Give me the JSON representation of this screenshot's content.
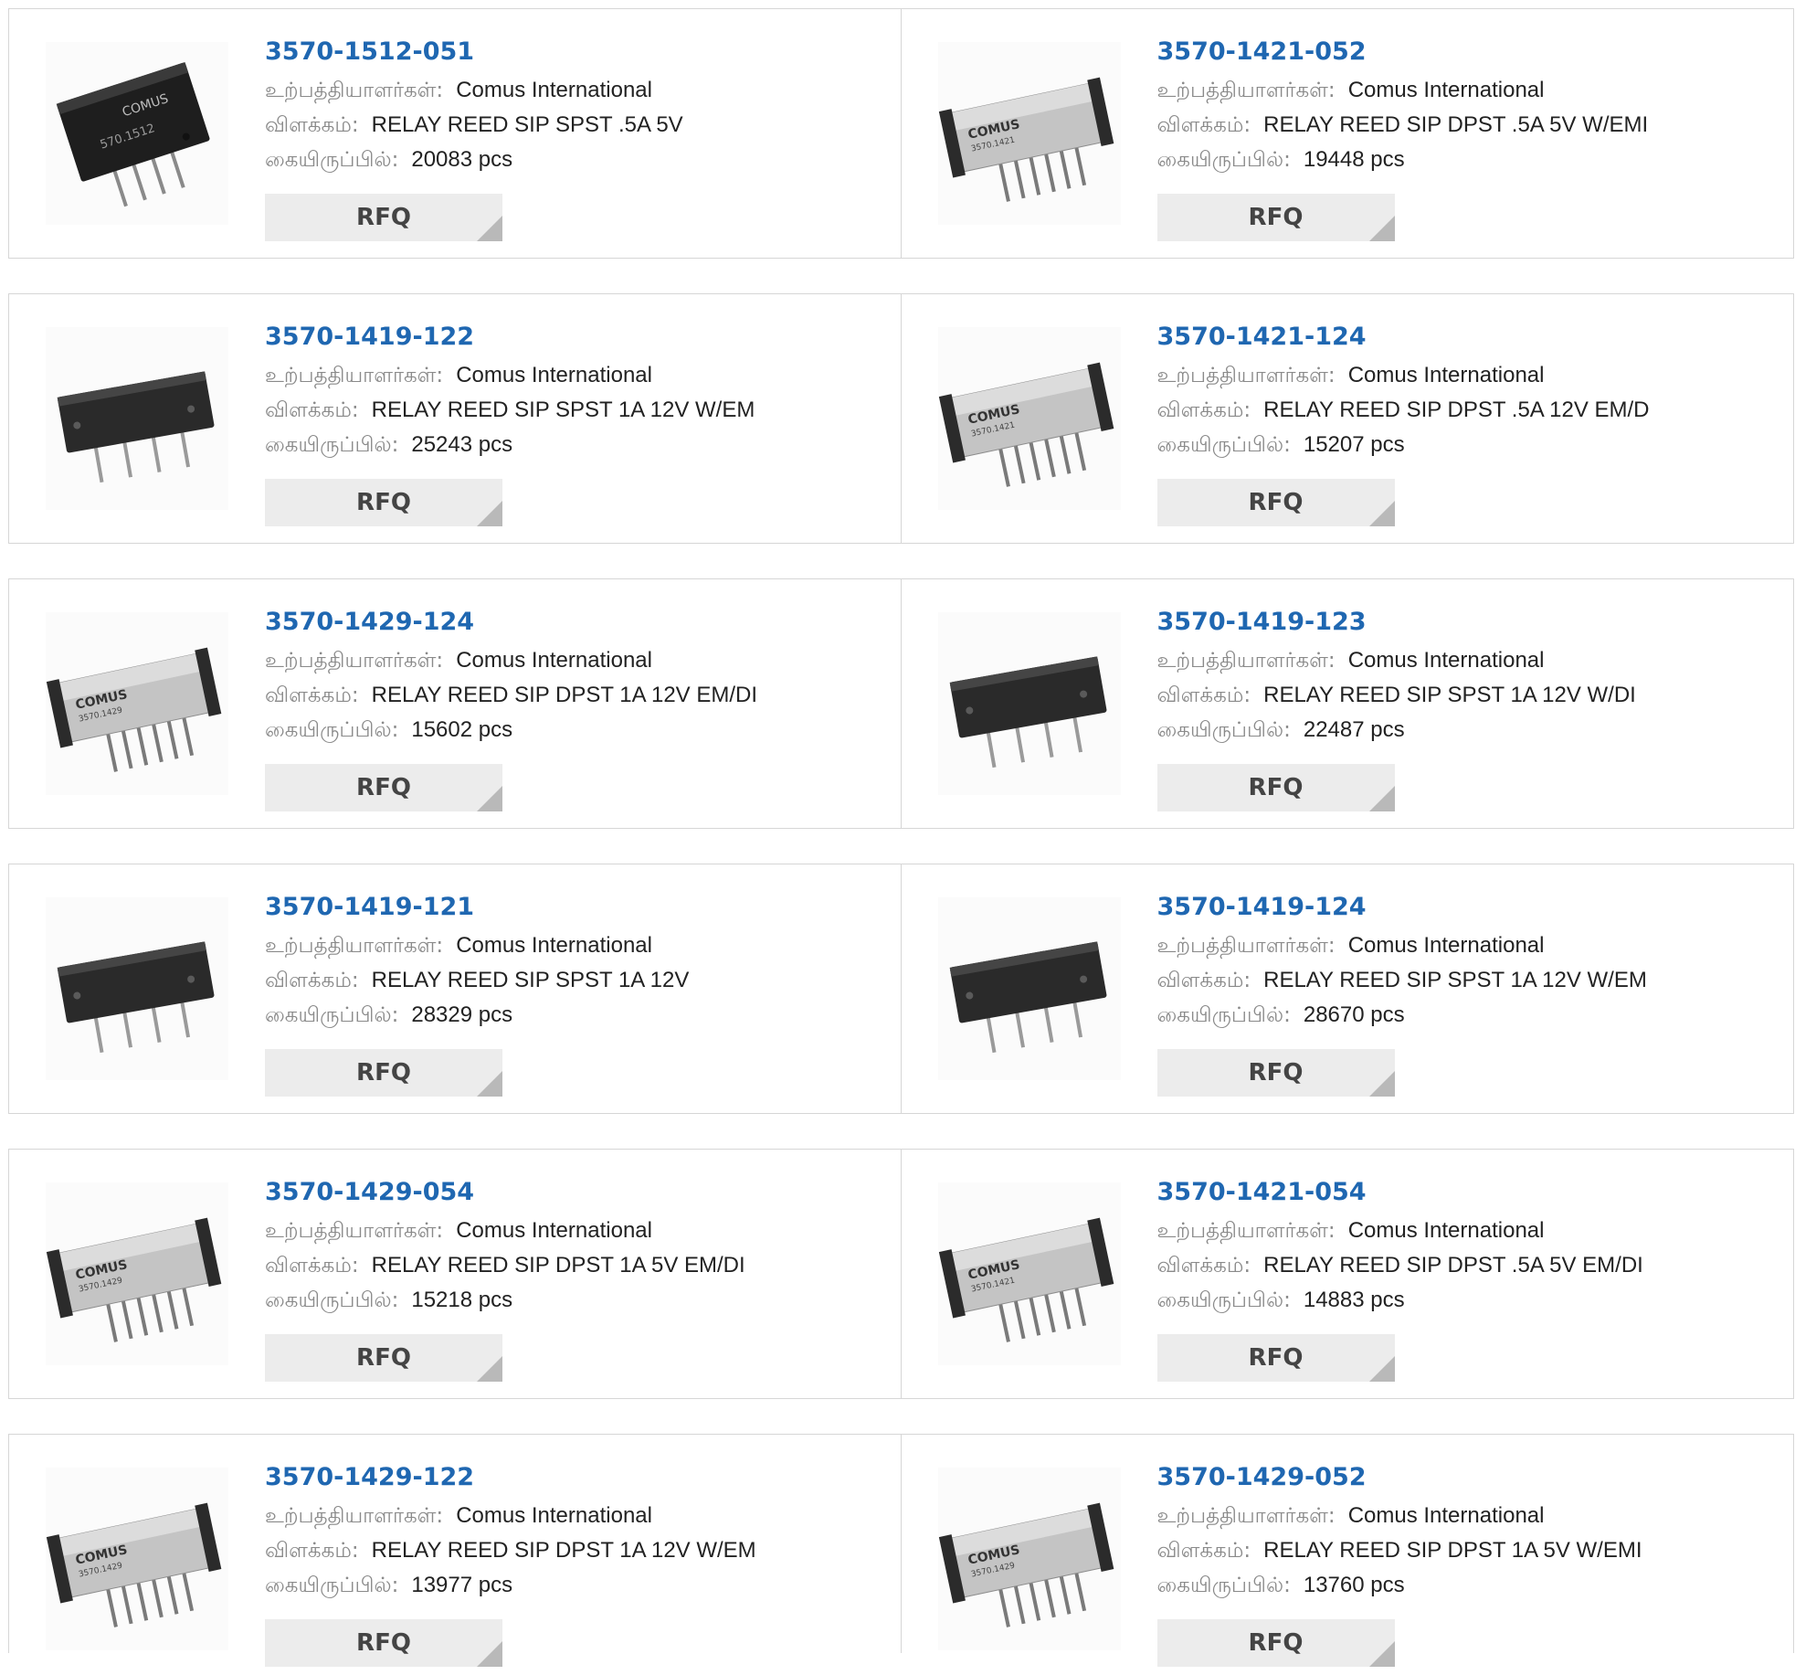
{
  "labels": {
    "manufacturer": "உற்பத்தியாளர்கள்:",
    "description": "விளக்கம்:",
    "stock": "கையிருப்பில்:"
  },
  "rfq_label": "RFQ",
  "colors": {
    "part_number": "#1f67b1",
    "label": "#8a8a8a",
    "button": "#ececec",
    "border": "#d6d6d6"
  },
  "products": [
    {
      "part": "3570-1512-051",
      "manufacturer": "Comus International",
      "description": "RELAY REED SIP SPST .5A 5V",
      "stock": "20083 pcs",
      "image": {
        "style": "black-slanted",
        "marking": "COMUS 570.1512"
      }
    },
    {
      "part": "3570-1421-052",
      "manufacturer": "Comus International",
      "description": "RELAY REED SIP DPST .5A 5V W/EMI",
      "stock": "19448 pcs",
      "image": {
        "style": "silver",
        "marking": "COMUS 3570.1421"
      }
    },
    {
      "part": "3570-1419-122",
      "manufacturer": "Comus International",
      "description": "RELAY REED SIP SPST 1A 12V W/EM",
      "stock": "25243 pcs",
      "image": {
        "style": "black",
        "marking": ""
      }
    },
    {
      "part": "3570-1421-124",
      "manufacturer": "Comus International",
      "description": "RELAY REED SIP DPST .5A 12V EM/D",
      "stock": "15207 pcs",
      "image": {
        "style": "silver",
        "marking": "COMUS 3570.1421"
      }
    },
    {
      "part": "3570-1429-124",
      "manufacturer": "Comus International",
      "description": "RELAY REED SIP DPST 1A 12V EM/DI",
      "stock": "15602 pcs",
      "image": {
        "style": "silver",
        "marking": "COMUS 3570.1429"
      }
    },
    {
      "part": "3570-1419-123",
      "manufacturer": "Comus International",
      "description": "RELAY REED SIP SPST 1A 12V W/DI",
      "stock": "22487 pcs",
      "image": {
        "style": "black",
        "marking": ""
      }
    },
    {
      "part": "3570-1419-121",
      "manufacturer": "Comus International",
      "description": "RELAY REED SIP SPST 1A 12V",
      "stock": "28329 pcs",
      "image": {
        "style": "black",
        "marking": ""
      }
    },
    {
      "part": "3570-1419-124",
      "manufacturer": "Comus International",
      "description": "RELAY REED SIP SPST 1A 12V W/EM",
      "stock": "28670 pcs",
      "image": {
        "style": "black",
        "marking": ""
      }
    },
    {
      "part": "3570-1429-054",
      "manufacturer": "Comus International",
      "description": "RELAY REED SIP DPST 1A 5V EM/DI",
      "stock": "15218 pcs",
      "image": {
        "style": "silver",
        "marking": "COMUS 3570.1429"
      }
    },
    {
      "part": "3570-1421-054",
      "manufacturer": "Comus International",
      "description": "RELAY REED SIP DPST .5A 5V EM/DI",
      "stock": "14883 pcs",
      "image": {
        "style": "silver",
        "marking": "COMUS 3570.1421"
      }
    },
    {
      "part": "3570-1429-122",
      "manufacturer": "Comus International",
      "description": "RELAY REED SIP DPST 1A 12V W/EM",
      "stock": "13977 pcs",
      "image": {
        "style": "silver",
        "marking": "COMUS 3570.1429"
      }
    },
    {
      "part": "3570-1429-052",
      "manufacturer": "Comus International",
      "description": "RELAY REED SIP DPST 1A 5V W/EMI",
      "stock": "13760 pcs",
      "image": {
        "style": "silver",
        "marking": "COMUS 3570.1429"
      }
    }
  ]
}
